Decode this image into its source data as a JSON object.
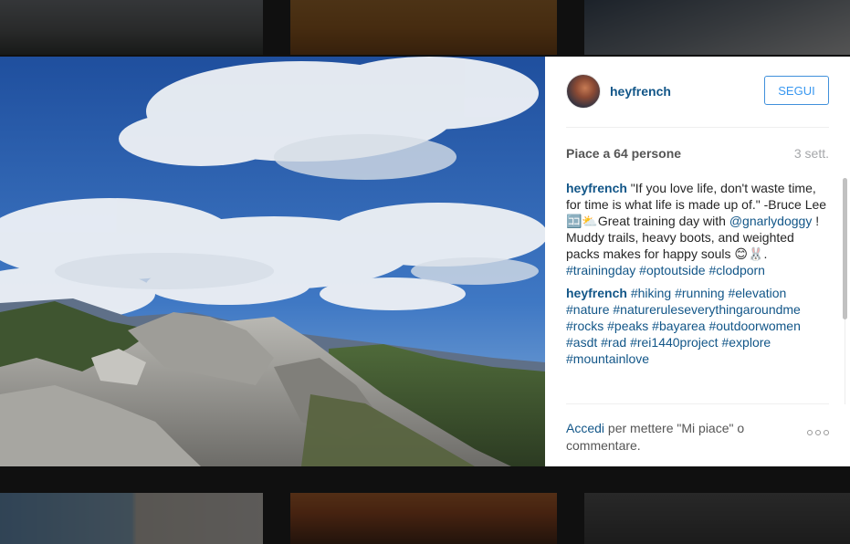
{
  "post": {
    "username": "heyfrench",
    "follow_label": "SEGUI",
    "likes_text": "Piace a 64 persone",
    "time_ago": "3 sett."
  },
  "comments": [
    {
      "user": "heyfrench",
      "parts": [
        {
          "type": "text",
          "value": " \"If you love life, don't waste time, for time is what life is made up of.\" -Bruce Lee 🈁⛅Great training day with "
        },
        {
          "type": "tag",
          "value": "@gnarlydoggy"
        },
        {
          "type": "text",
          "value": " ! Muddy trails, heavy boots, and weighted packs makes for happy souls 😊🐰. "
        },
        {
          "type": "tag",
          "value": "#trainingday"
        },
        {
          "type": "text",
          "value": " "
        },
        {
          "type": "tag",
          "value": "#optoutside"
        },
        {
          "type": "text",
          "value": " "
        },
        {
          "type": "tag",
          "value": "#clodporn"
        }
      ]
    },
    {
      "user": "heyfrench",
      "parts": [
        {
          "type": "text",
          "value": " "
        },
        {
          "type": "tag",
          "value": "#hiking"
        },
        {
          "type": "text",
          "value": " "
        },
        {
          "type": "tag",
          "value": "#running"
        },
        {
          "type": "text",
          "value": " "
        },
        {
          "type": "tag",
          "value": "#elevation"
        },
        {
          "type": "text",
          "value": " "
        },
        {
          "type": "tag",
          "value": "#nature"
        },
        {
          "type": "text",
          "value": " "
        },
        {
          "type": "tag",
          "value": "#natureruleseverythingaroundme"
        },
        {
          "type": "text",
          "value": " "
        },
        {
          "type": "tag",
          "value": "#rocks"
        },
        {
          "type": "text",
          "value": " "
        },
        {
          "type": "tag",
          "value": "#peaks"
        },
        {
          "type": "text",
          "value": " "
        },
        {
          "type": "tag",
          "value": "#bayarea"
        },
        {
          "type": "text",
          "value": " "
        },
        {
          "type": "tag",
          "value": "#outdoorwomen"
        },
        {
          "type": "text",
          "value": " "
        },
        {
          "type": "tag",
          "value": "#asdt"
        },
        {
          "type": "text",
          "value": " "
        },
        {
          "type": "tag",
          "value": "#rad"
        },
        {
          "type": "text",
          "value": " "
        },
        {
          "type": "tag",
          "value": "#rei1440project"
        },
        {
          "type": "text",
          "value": " "
        },
        {
          "type": "tag",
          "value": "#explore"
        },
        {
          "type": "text",
          "value": " "
        },
        {
          "type": "tag",
          "value": "#mountainlove"
        }
      ]
    }
  ],
  "footer": {
    "login_link": "Accedi",
    "login_text": " per mettere \"Mi piace\" o commentare."
  },
  "icons": {
    "more": "more-options-icon"
  },
  "colors": {
    "link": "#125688",
    "follow_border": "#4090db",
    "follow_text": "#3897f0",
    "overlay": "rgba(0,0,0,0.62)"
  }
}
